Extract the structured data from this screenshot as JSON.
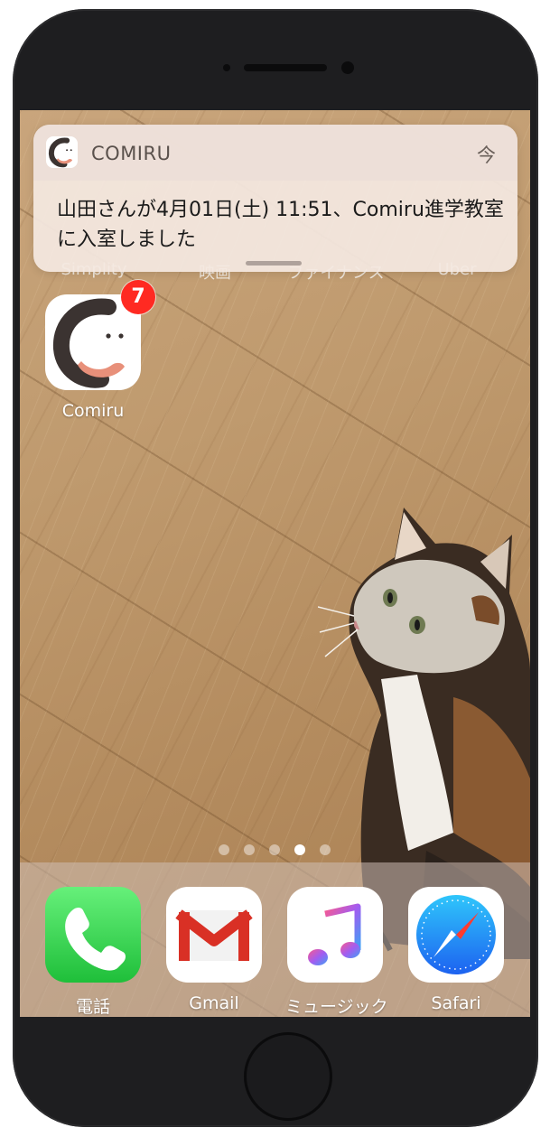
{
  "notification": {
    "app_name": "COMIRU",
    "time": "今",
    "message": "山田さんが4月01日(土) 11:51、Comiru進学教室に入室しました"
  },
  "hidden_labels": [
    "Simplity",
    "映画",
    "ファイナンス",
    "Uber"
  ],
  "home_apps": [
    {
      "label": "Comiru",
      "badge": "7",
      "icon": "comiru-icon"
    }
  ],
  "page_indicator": {
    "pages": 5,
    "current": 4
  },
  "dock": [
    {
      "label": "電話",
      "icon": "phone-icon"
    },
    {
      "label": "Gmail",
      "icon": "gmail-icon"
    },
    {
      "label": "ミュージック",
      "icon": "music-icon"
    },
    {
      "label": "Safari",
      "icon": "safari-icon"
    }
  ],
  "colors": {
    "badge": "#ff2a22",
    "comiru_dark": "#3b3331",
    "comiru_peach": "#e8907a",
    "phone_green": "#34c759",
    "gmail_red": "#d93025"
  }
}
